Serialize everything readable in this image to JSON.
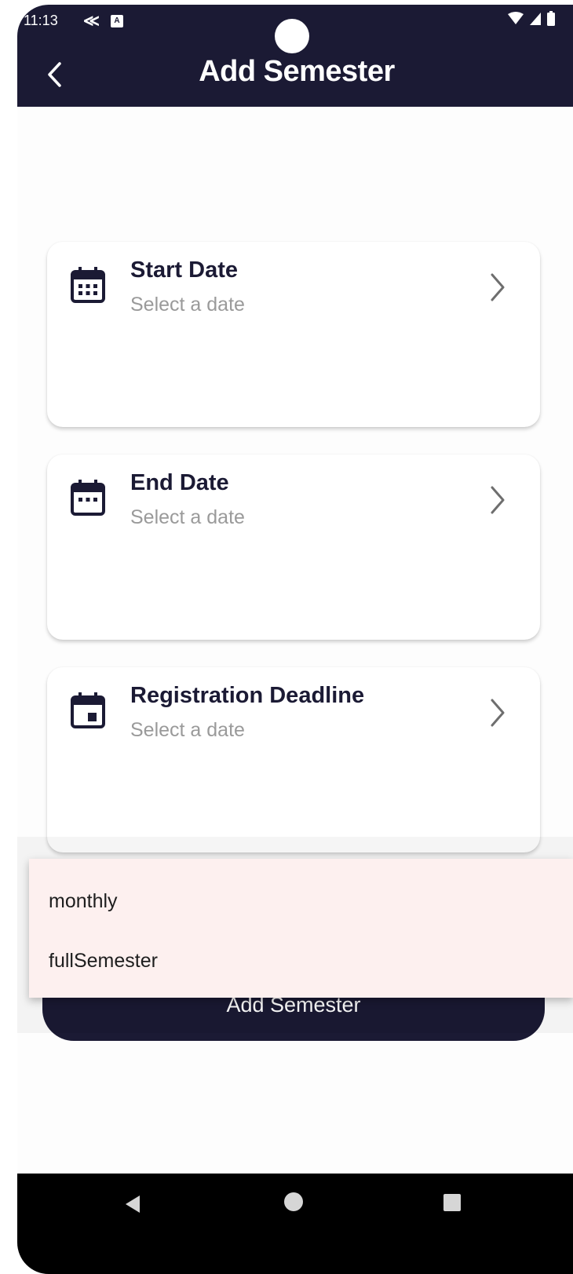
{
  "status_bar": {
    "time": "11:13"
  },
  "app_bar": {
    "title": "Add Semester",
    "back_icon": "chevron-left-icon"
  },
  "cards": [
    {
      "title": "Start Date",
      "subtitle": "Select a date",
      "icon": "calendar-grid-icon"
    },
    {
      "title": "End Date",
      "subtitle": "Select a date",
      "icon": "calendar-dots-icon"
    },
    {
      "title": "Registration Deadline",
      "subtitle": "Select a date",
      "icon": "calendar-event-icon"
    }
  ],
  "dropdown": {
    "options": [
      "monthly",
      "fullSemester"
    ]
  },
  "primary_button": {
    "label": "Add Semester"
  },
  "colors": {
    "primary": "#1b1a34",
    "dropdown_bg": "#fdf0ef",
    "subtitle": "#9a9a9a"
  }
}
